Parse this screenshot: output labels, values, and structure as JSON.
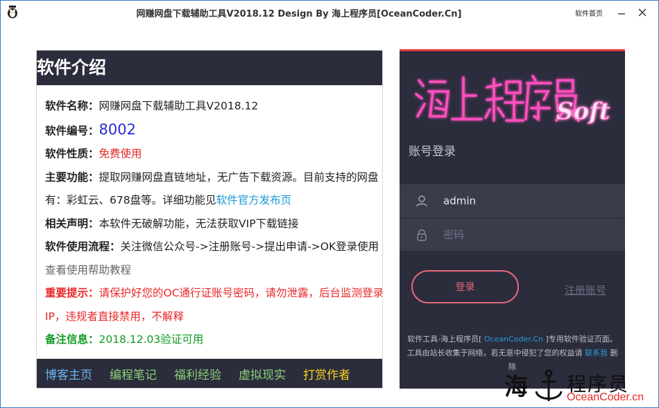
{
  "window": {
    "title": "网赚网盘下载辅助工具V2018.12   Design  By 海上程序员[OceanCoder.Cn]",
    "home_link": "软件首页"
  },
  "intro": {
    "header": "软件介绍",
    "name_label": "软件名称：",
    "name_value": "网赚网盘下载辅助工具V2018.12",
    "code_label": "软件编号：",
    "code_value": "8002",
    "nature_label": "软件性质：",
    "nature_value": "免费使用",
    "feature_label": "主要功能：",
    "feature_value": "提取网赚网盘直链地址，无广告下载资源。目前支持的网盘有：彩虹云、678盘等。详细功能见",
    "feature_link": "软件官方发布页",
    "statement_label": "相关声明：",
    "statement_value": "本软件无破解功能，无法获取VIP下载链接",
    "flow_label": "软件使用流程：",
    "flow_value": "关注微信公众号->注册账号->提出申请->OK登录使用 ",
    "flow_link": "查看使用帮助教程",
    "warn_label": "重要提示：",
    "warn_value": "请保护好您的OC通行证账号密码，请勿泄露，后台监测登录IP，违规者直接禁用，不解释",
    "note_label": "备注信息：",
    "note_value": "2018.12.03验证可用",
    "footer_links": [
      {
        "label": "博客主页",
        "color": "#6bb6f0"
      },
      {
        "label": "编程笔记",
        "color": "#8fd37a"
      },
      {
        "label": "福利经验",
        "color": "#8fd37a"
      },
      {
        "label": "虚拟现实",
        "color": "#8fd37a"
      },
      {
        "label": "打赏作者",
        "color": "#f5d51b"
      }
    ]
  },
  "login": {
    "logo_text": "海上程序员",
    "logo_soft": "Soft",
    "heading": "账号登录",
    "username": "admin",
    "password_placeholder": "密码",
    "login_button": "登录",
    "register_link": "注册账号",
    "note_prefix": "软件工具-海上程序员[ ",
    "note_link": "OceanCoder.Cn",
    "note_mid": " ]专用软件验证页面。工具由站长收集于网络，若无意中侵犯了您的权益请 ",
    "note_contact": "联系我",
    "note_suffix": " 删除"
  },
  "watermark": {
    "char": "海",
    "text": "程序员",
    "url": "OceanCoder.cn"
  },
  "colors": {
    "accent_red": "#e63b3b",
    "panel_dark": "#2b2c3c",
    "link_blue": "#1b9ad6"
  }
}
